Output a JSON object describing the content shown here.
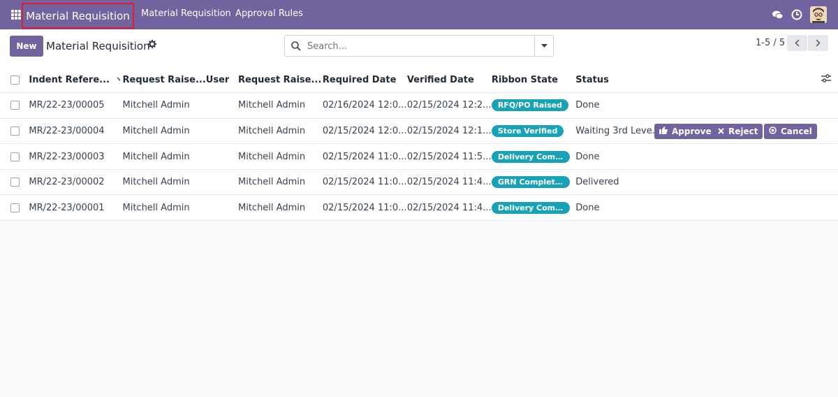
{
  "navbar": {
    "brand": "Material Requisition",
    "menu": [
      "Material Requisition",
      "Approval Rules"
    ]
  },
  "control": {
    "new_label": "New",
    "title": "Material Requisition",
    "search_placeholder": "Search...",
    "pager": "1-5 / 5"
  },
  "table": {
    "headers": [
      "Indent Refere...",
      "Request Raise...",
      "User",
      "Request Raise...",
      "Required Date",
      "Verified Date",
      "Ribbon State",
      "Status"
    ],
    "rows": [
      {
        "ref": "MR/22-23/00005",
        "req1": "Mitchell Admin",
        "user": "",
        "req2": "Mitchell Admin",
        "required": "02/16/2024 12:0...",
        "verified": "02/15/2024 12:2...",
        "ribbon": "RFQ/PO Raised",
        "status": "Done"
      },
      {
        "ref": "MR/22-23/00004",
        "req1": "Mitchell Admin",
        "user": "",
        "req2": "Mitchell Admin",
        "required": "02/15/2024 12:0...",
        "verified": "02/15/2024 12:1...",
        "ribbon": "Store Verified",
        "status": "Waiting 3rd Leve..."
      },
      {
        "ref": "MR/22-23/00003",
        "req1": "Mitchell Admin",
        "user": "",
        "req2": "Mitchell Admin",
        "required": "02/15/2024 11:0...",
        "verified": "02/15/2024 11:5...",
        "ribbon": "Delivery Compl...",
        "status": "Done"
      },
      {
        "ref": "MR/22-23/00002",
        "req1": "Mitchell Admin",
        "user": "",
        "req2": "Mitchell Admin",
        "required": "02/15/2024 11:0...",
        "verified": "02/15/2024 11:4...",
        "ribbon": "GRN Completed",
        "status": "Delivered"
      },
      {
        "ref": "MR/22-23/00001",
        "req1": "Mitchell Admin",
        "user": "",
        "req2": "Mitchell Admin",
        "required": "02/15/2024 11:0...",
        "verified": "02/15/2024 11:4...",
        "ribbon": "Delivery Compl...",
        "status": "Done"
      }
    ],
    "row_actions": {
      "approve": "Approve",
      "reject": "Reject",
      "cancel": "Cancel"
    }
  },
  "colors": {
    "navbar": "#71639e",
    "badge": "#17a2b8",
    "brand_highlight": "#e11d2a"
  },
  "icons": [
    "apps-grid-icon",
    "chat-icon",
    "clock-icon",
    "avatar",
    "gear-icon",
    "search-icon",
    "caret-down-icon",
    "chevron-left-icon",
    "chevron-right-icon",
    "sort-down-icon",
    "column-settings-icon",
    "thumbs-up-icon",
    "x-icon",
    "cancel-circle-icon"
  ]
}
